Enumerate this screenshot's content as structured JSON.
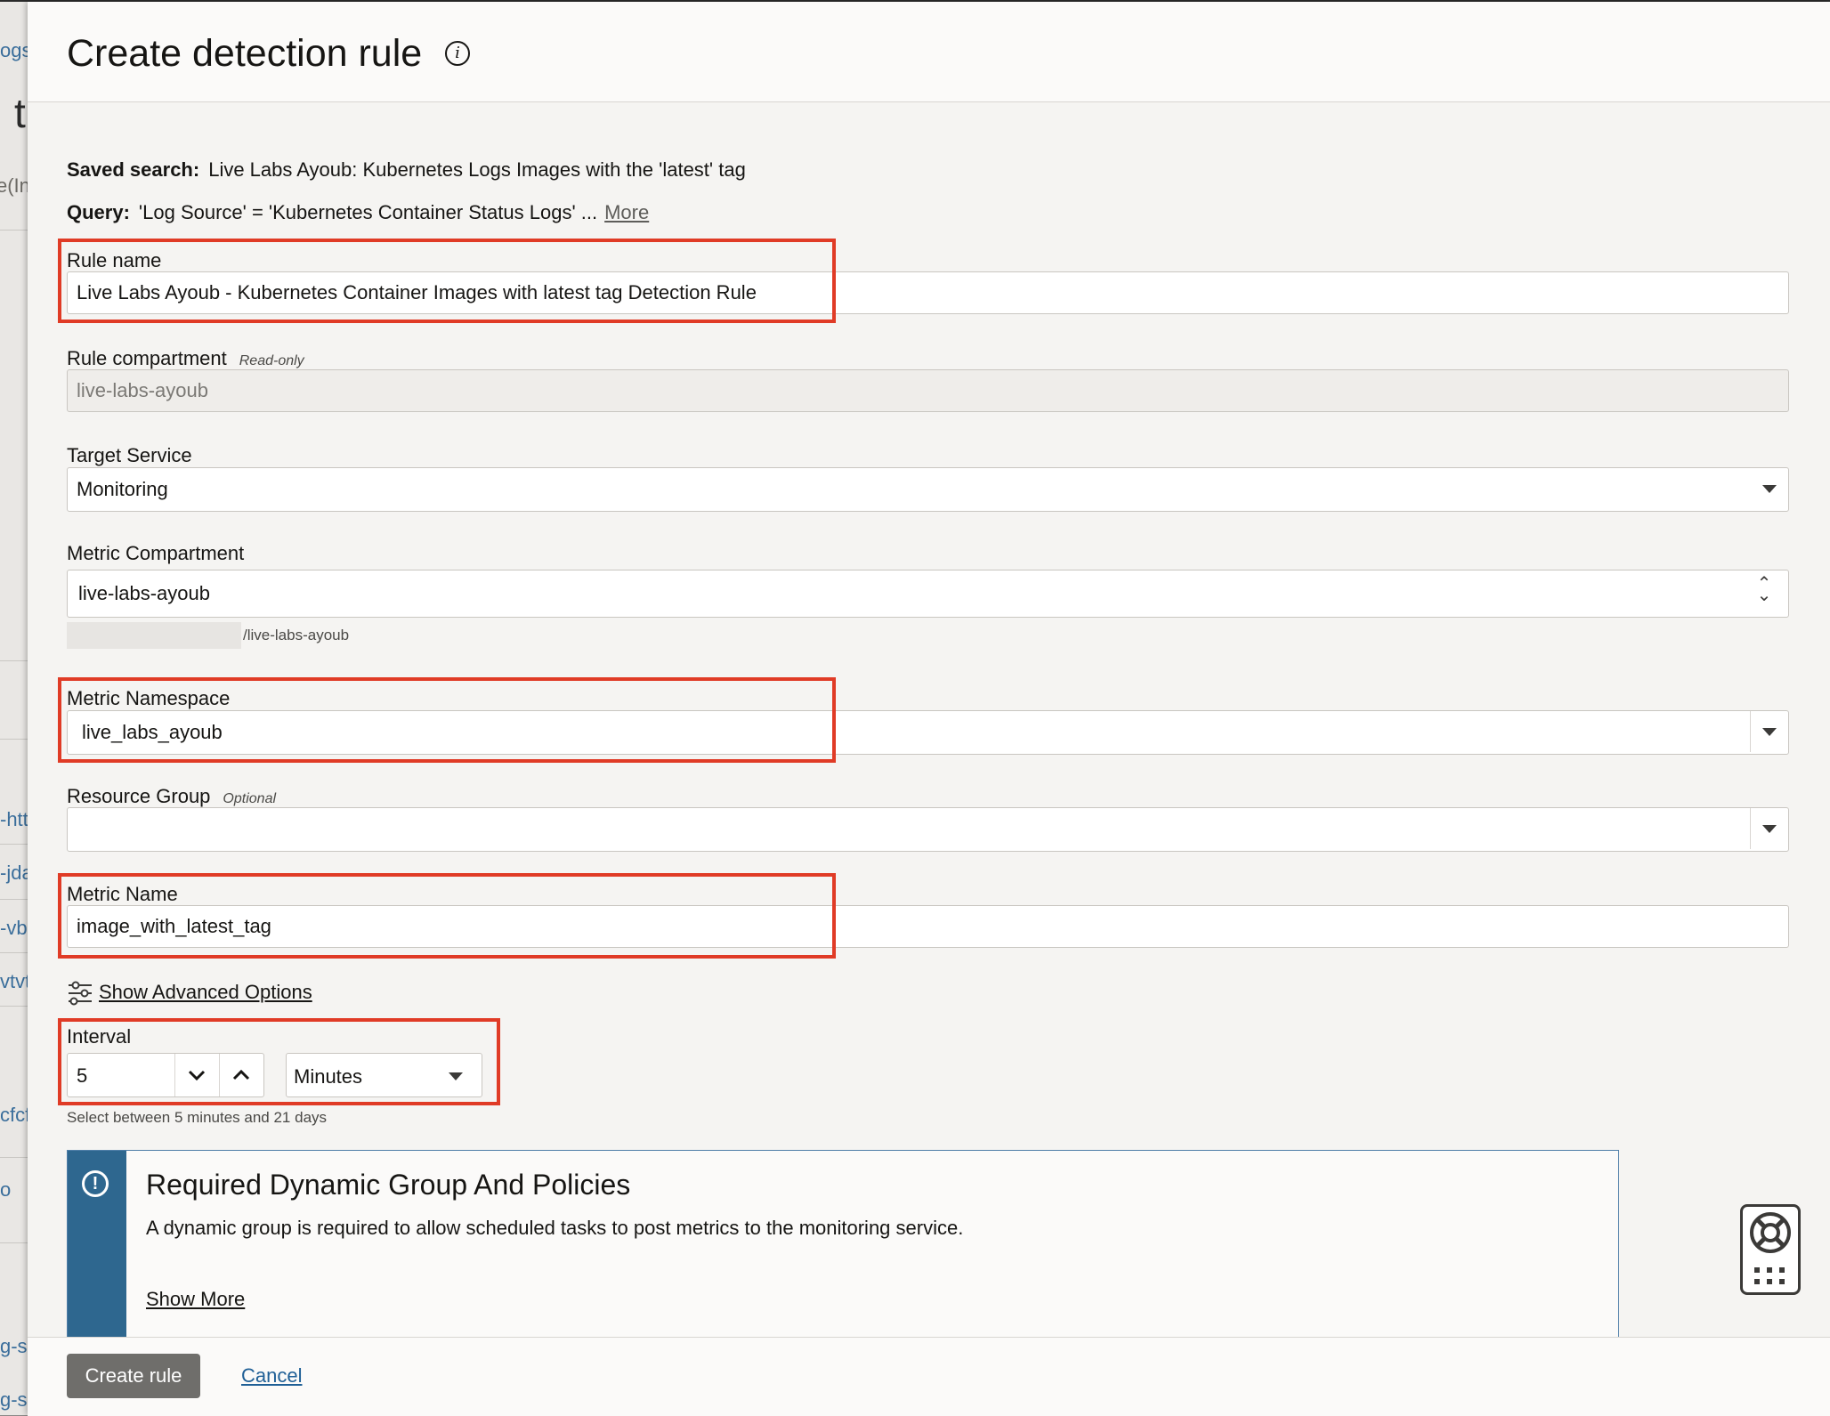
{
  "background_fragments": [
    "ogs",
    "t",
    "e(In",
    "-htt",
    "-jda",
    "-vb",
    "vtvt",
    "cfcf",
    "o",
    "g-s",
    "g-s"
  ],
  "dialog": {
    "title": "Create detection rule",
    "info_icon": "info-icon",
    "saved_search": {
      "label": "Saved search:",
      "value": "Live Labs Ayoub: Kubernetes Logs Images with the 'latest' tag"
    },
    "query": {
      "label": "Query:",
      "value": "'Log Source' = 'Kubernetes Container Status Logs' ...",
      "more_link": "More"
    },
    "rule_name": {
      "label": "Rule name",
      "value": "Live Labs Ayoub - Kubernetes Container Images with latest tag Detection Rule"
    },
    "rule_compartment": {
      "label": "Rule compartment",
      "hint": "Read-only",
      "value": "live-labs-ayoub"
    },
    "target_service": {
      "label": "Target Service",
      "value": "Monitoring"
    },
    "metric_compartment": {
      "label": "Metric Compartment",
      "value": "live-labs-ayoub",
      "path_suffix": "/live-labs-ayoub"
    },
    "metric_namespace": {
      "label": "Metric Namespace",
      "value": "live_labs_ayoub"
    },
    "resource_group": {
      "label": "Resource Group",
      "hint": "Optional",
      "value": ""
    },
    "metric_name": {
      "label": "Metric Name",
      "value": "image_with_latest_tag"
    },
    "advanced_options": {
      "label": "Show Advanced Options",
      "icon": "sliders-icon"
    },
    "interval": {
      "label": "Interval",
      "value": "5",
      "unit": "Minutes",
      "helper": "Select between 5 minutes and 21 days"
    },
    "notice": {
      "title": "Required Dynamic Group And Policies",
      "text": "A dynamic group is required to allow scheduled tasks to post metrics to the monitoring service.",
      "link": "Show More",
      "icon": "exclamation-circle-icon"
    },
    "footer": {
      "create_label": "Create rule",
      "cancel_label": "Cancel"
    }
  },
  "colors": {
    "highlight": "#e03b26",
    "notice_band": "#2e678f",
    "primary_button": "#6f6e6b",
    "link": "#1f5f96"
  },
  "help_widget": {
    "icon": "lifebuoy-icon",
    "grid_icon": "grid-dots-icon"
  }
}
